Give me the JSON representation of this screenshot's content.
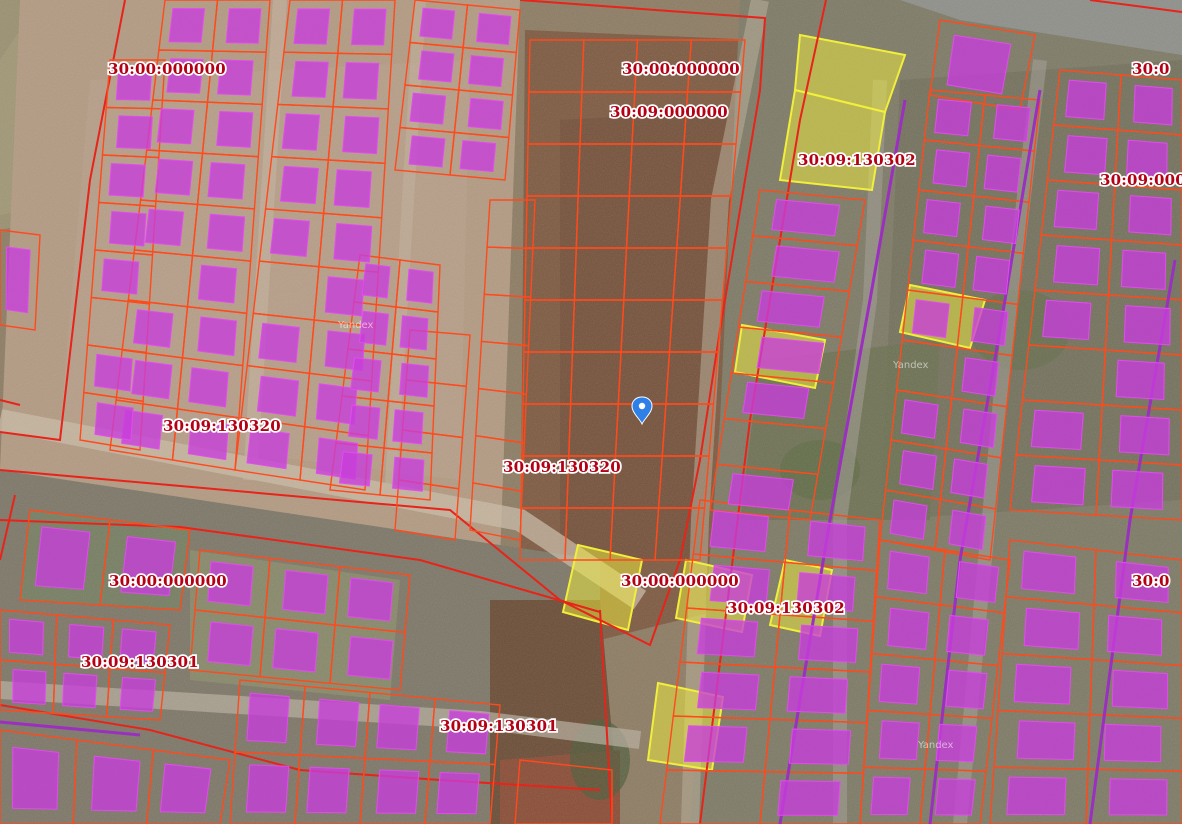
{
  "map": {
    "labels": [
      "30:00:000000",
      "30:00:000000",
      "30:09:000000",
      "30:09:130302",
      "30:09:130320",
      "30:09:130320",
      "30:00:000000",
      "30:00:000000",
      "30:09:130302",
      "30:09:130301",
      "30:09:130301",
      "30:0",
      "30:09:000",
      "30:0"
    ],
    "watermark": "Yandex",
    "marker": "location-pin"
  },
  "colors": {
    "parcel_outline": "#ff4a1c",
    "quarter_outline": "#e8231a",
    "building_fill": "#c83cdc",
    "highlight_fill": "#f2ee3c",
    "road_line": "#9a2fc0",
    "marker": "#2f7fe8",
    "label_text": "#b40014"
  }
}
